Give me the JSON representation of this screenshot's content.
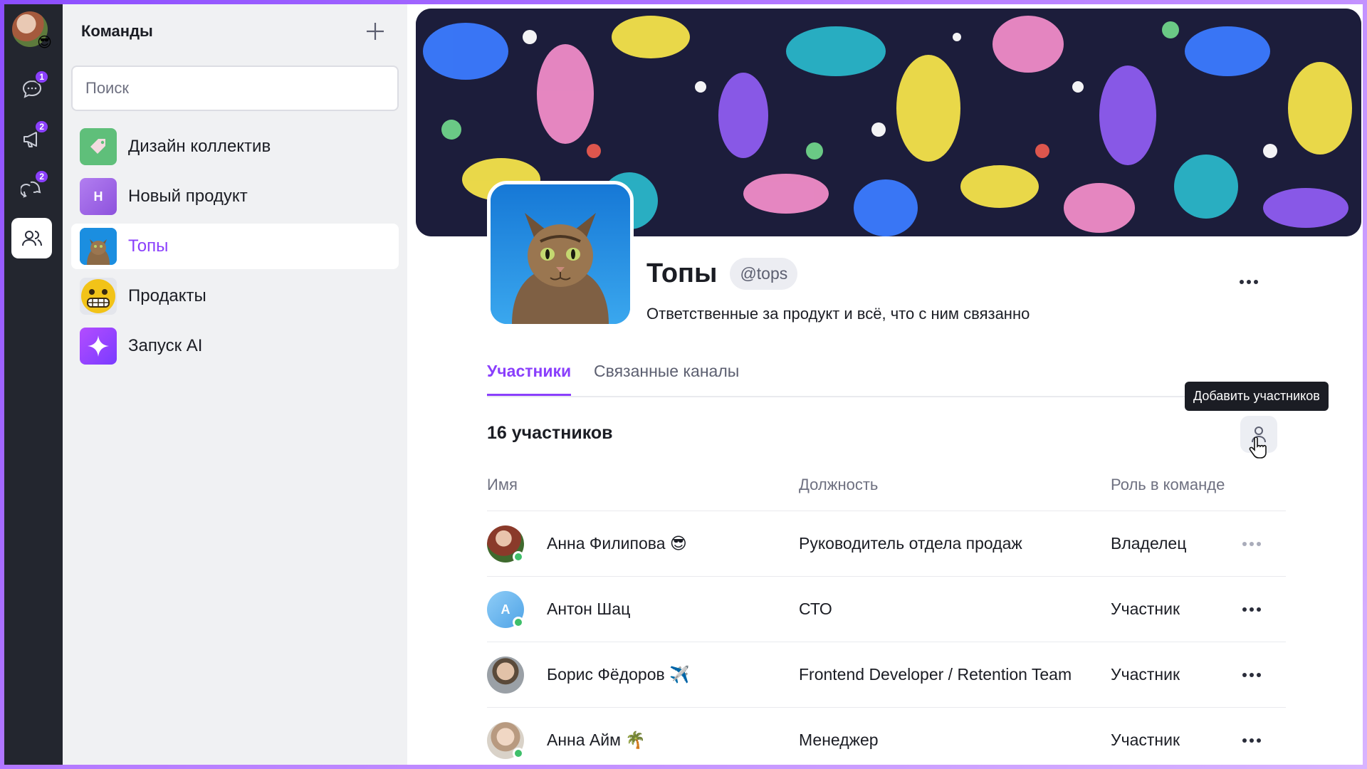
{
  "rail": {
    "badges": {
      "chats": "1",
      "channels": "2",
      "threads": "2"
    },
    "status_emoji": "😎"
  },
  "teams_panel": {
    "title": "Команды",
    "search_placeholder": "Поиск",
    "items": [
      {
        "label": "Дизайн коллектив",
        "icon": "tag-icon",
        "color": "#5fbf7a"
      },
      {
        "label": "Новый продукт",
        "icon_letter": "Н",
        "color": "#a46be8"
      },
      {
        "label": "Топы",
        "icon": "cat-photo",
        "active": true
      },
      {
        "label": "Продакты",
        "icon": "grimace-emoji",
        "color": "#f2c318"
      },
      {
        "label": "Запуск AI",
        "icon": "sparkle-icon",
        "color": "#9b4dff"
      }
    ]
  },
  "team": {
    "name": "Топы",
    "handle": "@tops",
    "description": "Ответственные за продукт и всё, что с ним связанно"
  },
  "tabs": [
    {
      "label": "Участники",
      "active": true
    },
    {
      "label": "Связанные каналы",
      "active": false
    }
  ],
  "members": {
    "count_label": "16 участников",
    "add_tooltip": "Добавить участников",
    "columns": {
      "name": "Имя",
      "position": "Должность",
      "role": "Роль в команде"
    },
    "rows": [
      {
        "name": "Анна Филипова 😎",
        "position": "Руководитель отдела продаж",
        "role": "Владелец",
        "online": true,
        "avatar_color": "#7a3b2e"
      },
      {
        "name": "Антон Шац",
        "position": "СТО",
        "role": "Участник",
        "online": true,
        "avatar_letter": "А",
        "avatar_color": "#6fb6ef"
      },
      {
        "name": "Борис Фёдоров ✈️",
        "position": "Frontend Developer / Retention Team",
        "role": "Участник",
        "online": false,
        "avatar_color": "#8a8f96"
      },
      {
        "name": "Анна Айм 🌴",
        "position": "Менеджер",
        "role": "Участник",
        "online": true,
        "avatar_color": "#cfbfb0"
      }
    ]
  },
  "colors": {
    "accent": "#8a3ffc",
    "rail_bg": "#23262f",
    "panel_bg": "#f0f1f3",
    "online": "#3fbf6a"
  }
}
